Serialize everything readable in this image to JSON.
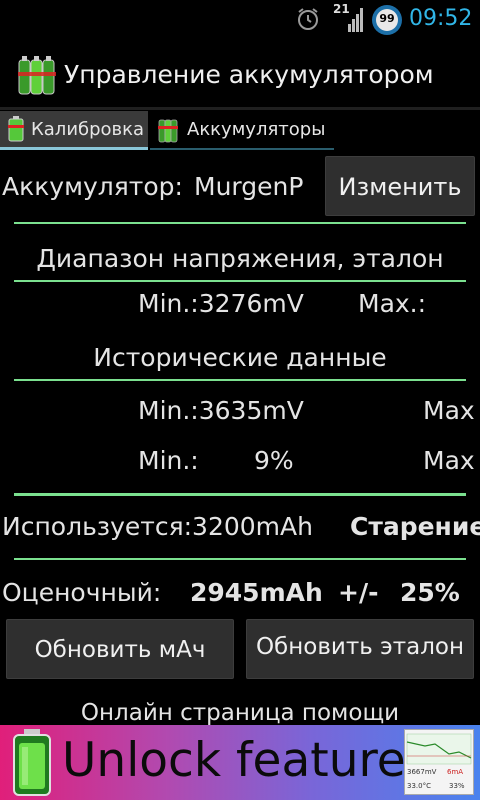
{
  "status_bar": {
    "network_type": "21",
    "battery_level": "99",
    "time": "09:52",
    "icons": [
      "alarm-icon",
      "signal-icon",
      "battery-circle-icon"
    ],
    "time_color": "#31b6e7"
  },
  "app": {
    "title": "Управление аккумулятором",
    "icon": "battery-green-icon"
  },
  "tabs": [
    {
      "label": "Калибровка",
      "selected": true
    },
    {
      "label": "Аккумуляторы",
      "selected": false
    }
  ],
  "battery": {
    "label": "Аккумулятор:",
    "name": "MurgenP",
    "change_button": "Изменить"
  },
  "voltage_range": {
    "heading": "Диапазон напряжения, эталон",
    "min": "Min.:3276mV",
    "max": "Max.:"
  },
  "historical": {
    "heading": "Исторические данные",
    "min_voltage": "Min.:3635mV",
    "max_voltage": "Max",
    "min_percent_label": "Min.:",
    "min_percent_value": "9%",
    "max_percent": "Max"
  },
  "usage": {
    "used": "Используется:3200mAh",
    "aging": "Старение"
  },
  "estimate": {
    "label": "Оценочный:",
    "value": "2945mAh",
    "plus_minus": "+/-",
    "percent": "25%"
  },
  "buttons": {
    "update_mah": "Обновить мАч",
    "update_reference": "Обновить эталон"
  },
  "help_link": "Онлайн страница помощи",
  "ad": {
    "text": "Unlock features",
    "preview_line_1": "3667mV",
    "preview_line_2": "6mA",
    "preview_line_3": "33.0°C",
    "preview_line_4": "33%",
    "accent_color": "#7be08f"
  }
}
